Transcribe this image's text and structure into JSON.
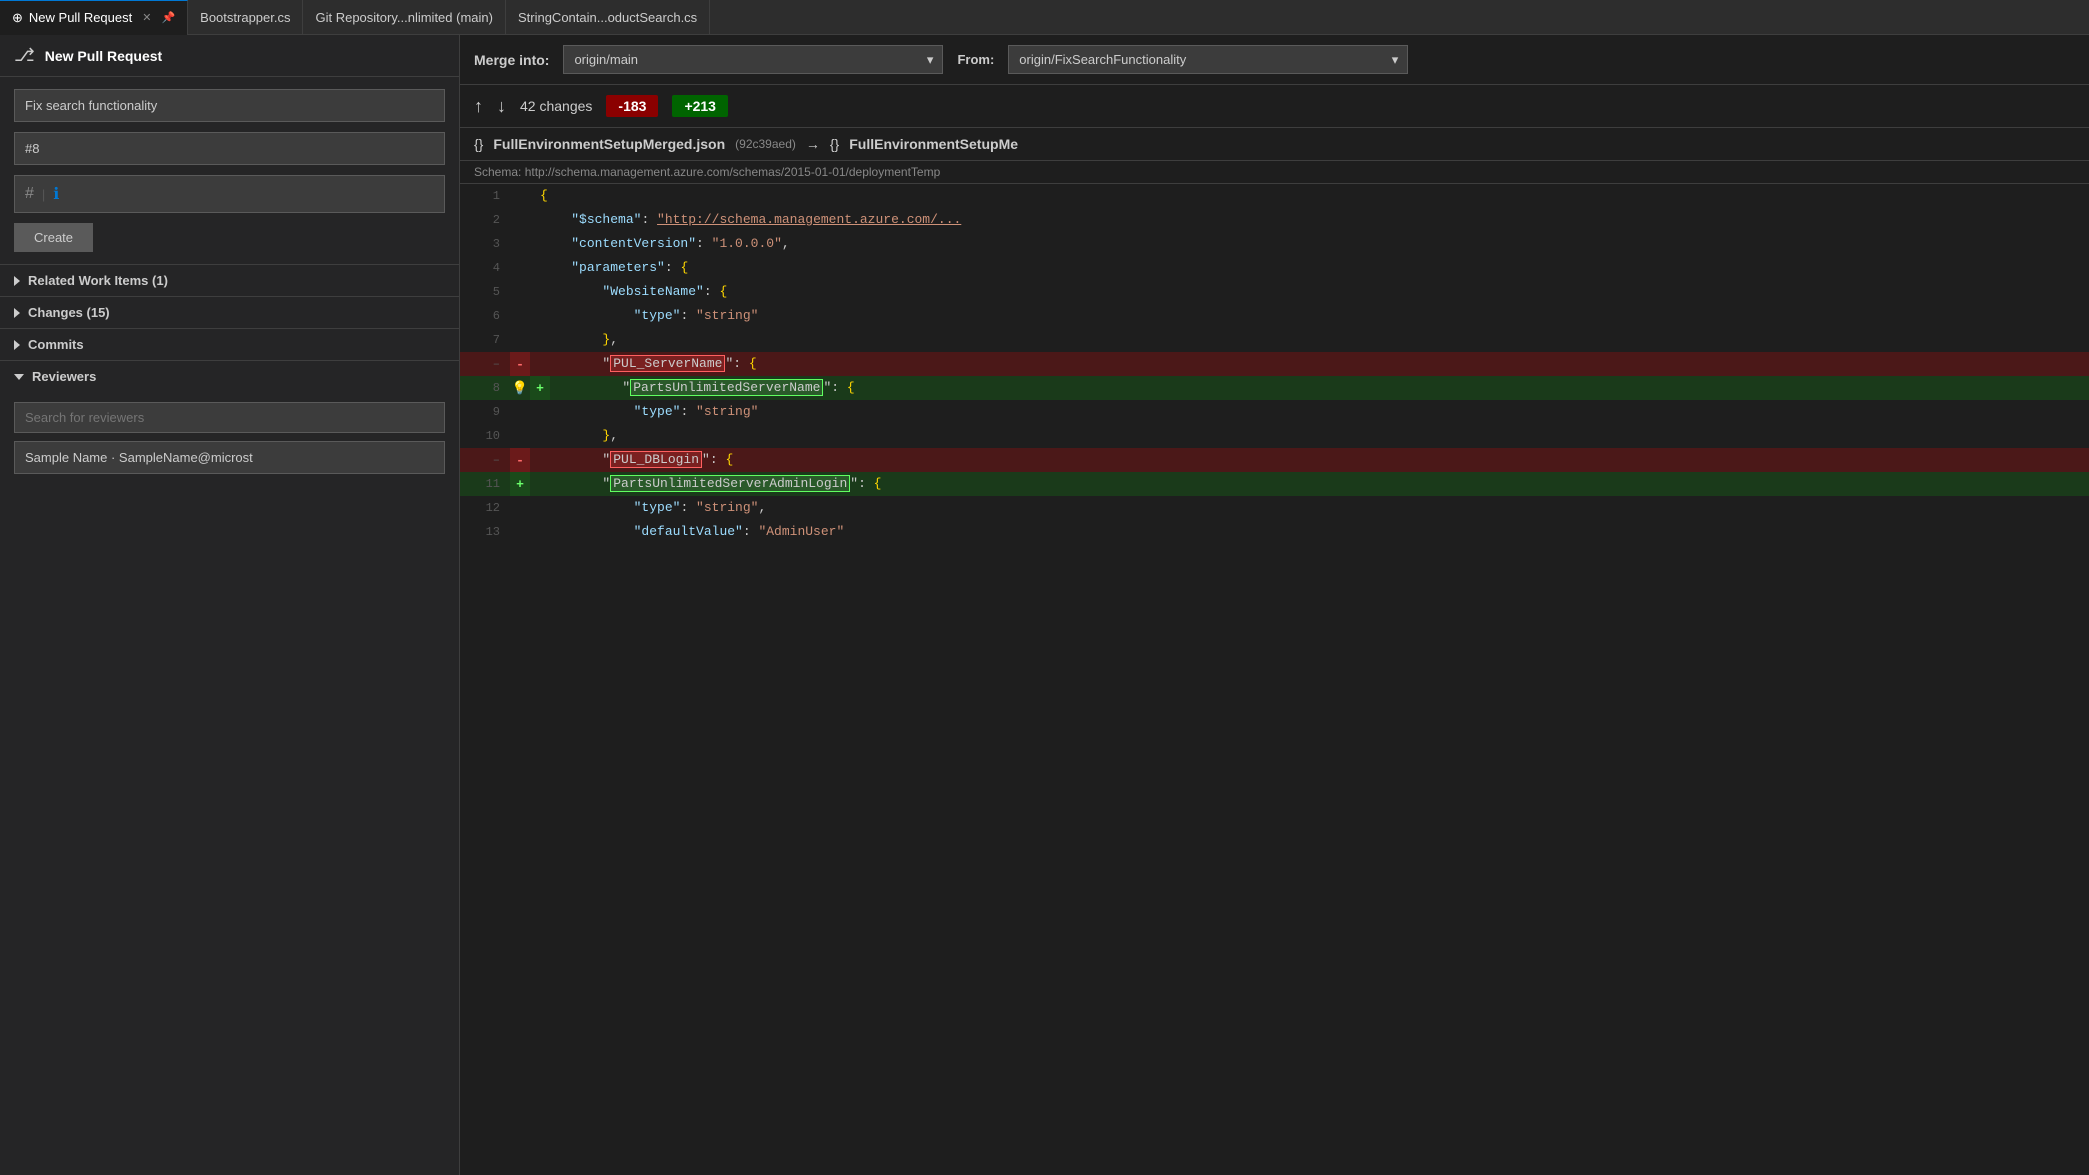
{
  "tabs": [
    {
      "label": "New Pull Request",
      "icon": "⊕",
      "active": true,
      "closable": true
    },
    {
      "label": "Bootstrapper.cs",
      "active": false
    },
    {
      "label": "Git Repository...nlimited (main)",
      "active": false
    },
    {
      "label": "StringContain...oductSearch.cs",
      "active": false
    }
  ],
  "header": {
    "icon": "⎇",
    "title": "New Pull Request",
    "merge_into_label": "Merge into:",
    "merge_branch": "origin/main",
    "from_label": "From:",
    "from_branch": "origin/FixSearchFunctionality"
  },
  "pr": {
    "title": "Fix search functionality",
    "number": "#8",
    "description_placeholder": "",
    "create_label": "Create"
  },
  "sections": {
    "related_work_items": "Related Work Items (1)",
    "changes": "Changes (15)",
    "commits": "Commits",
    "reviewers": "Reviewers"
  },
  "reviewers": {
    "search_placeholder": "Search for reviewers",
    "reviewer_name": "Sample Name · SampleName@microst"
  },
  "diff": {
    "changes_count": "42 changes",
    "deletions": "-183",
    "additions": "+213",
    "file_name": "FullEnvironmentSetupMerged.json",
    "file_hash_old": "92c39aed",
    "file_name_new": "FullEnvironmentSetupMe",
    "arrow": "→",
    "schema_label": "Schema:",
    "schema_url": "http://schema.management.azure.com/schemas/2015-01-01/deploymentTemp"
  },
  "code_lines": [
    {
      "num": 1,
      "type": "normal",
      "gutter": "",
      "content": "{"
    },
    {
      "num": 2,
      "type": "normal",
      "gutter": "",
      "content": "    \"$schema\": \"http://schema.management.azure.com/..."
    },
    {
      "num": 3,
      "type": "normal",
      "gutter": "",
      "content": "    \"contentVersion\": \"1.0.0.0\","
    },
    {
      "num": 4,
      "type": "normal",
      "gutter": "",
      "content": "    \"parameters\": {"
    },
    {
      "num": 5,
      "type": "normal",
      "gutter": "",
      "content": "        \"WebsiteName\": {"
    },
    {
      "num": 6,
      "type": "normal",
      "gutter": "",
      "content": "            \"type\": \"string\""
    },
    {
      "num": 7,
      "type": "normal",
      "gutter": "",
      "content": "        },"
    },
    {
      "num": "–",
      "type": "deleted",
      "gutter": "-",
      "content": "        \"PUL_ServerName\": {"
    },
    {
      "num": "8",
      "type": "added",
      "gutter": "+",
      "content": "        \"PartsUnlimitedServerName\": {",
      "hint": true
    },
    {
      "num": 9,
      "type": "normal",
      "gutter": "",
      "content": "            \"type\": \"string\""
    },
    {
      "num": 10,
      "type": "normal",
      "gutter": "",
      "content": "        },"
    },
    {
      "num": "–",
      "type": "deleted",
      "gutter": "-",
      "content": "        \"PUL_DBLogin\": {"
    },
    {
      "num": 11,
      "type": "added",
      "gutter": "+",
      "content": "        \"PartsUnlimitedServerAdminLogin\": {"
    },
    {
      "num": 12,
      "type": "normal",
      "gutter": "",
      "content": "            \"type\": \"string\","
    },
    {
      "num": 13,
      "type": "normal",
      "gutter": "",
      "content": "            \"defaultValue\": \"AdminUser\""
    }
  ]
}
